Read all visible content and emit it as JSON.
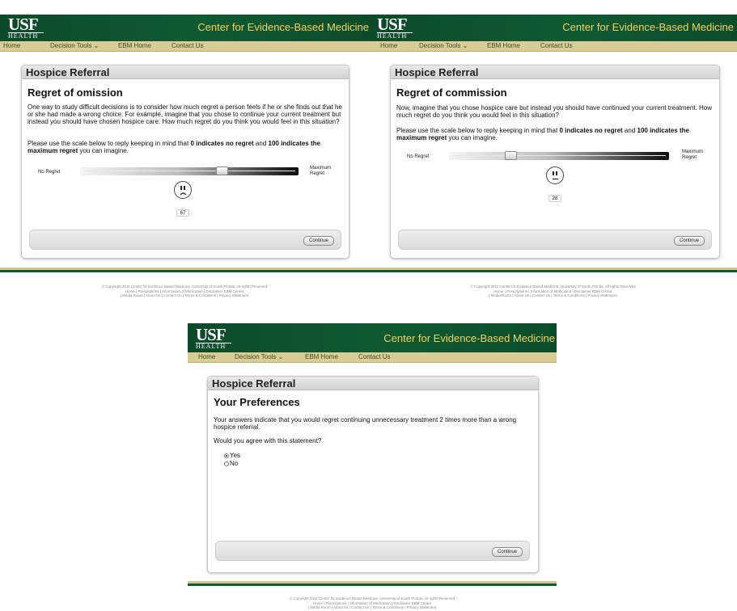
{
  "brand": {
    "logo": "USF",
    "logo_sub": "HEALTH",
    "site_title": "Center for Evidence-Based Medicine"
  },
  "nav": {
    "home": "Home",
    "decision_tools": "Decision Tools ⌄",
    "ebm_home": "EBM Home",
    "contact_us": "Contact Us"
  },
  "panel_a": {
    "header": "Hospice Referral",
    "title": "Regret of omission",
    "paragraph1": "One way to study difficult decisions is to consider how much regret a person feels if he or she finds out that he or she had made a wrong choice. For example, imagine that you chose to continue your current treatment but instead you should have chosen hospice care. How much regret do you think you would feel in this situation?",
    "instruction_pre": "Please use the scale below to reply keeping in mind that ",
    "instruction_b1": "0 indicates no regret",
    "instruction_mid": " and ",
    "instruction_b2": "100 indicates the maximum regret",
    "instruction_post": " you can imagine.",
    "scale_min_label": "No Regret",
    "scale_max_label": "Maximum Regret",
    "slider_value": "67",
    "continue_label": "Continue"
  },
  "panel_b": {
    "header": "Hospice Referral",
    "title": "Regret of commission",
    "paragraph1": "Now, imagine that you chose hospice care but instead you should have continued your current treatment. How much regret do you think you would feel in this situation?",
    "instruction_pre": "Please use the scale below to reply keeping in mind that ",
    "instruction_b1": "0 indicates no regret",
    "instruction_mid": " and ",
    "instruction_b2": "100 indicates the maximum regret",
    "instruction_post": " you can imagine.",
    "scale_min_label": "No Regret",
    "scale_max_label": "Maximum Regret",
    "slider_value": "28",
    "continue_label": "Continue"
  },
  "panel_c": {
    "header": "Hospice Referral",
    "title": "Your Preferences",
    "paragraph1": "Your answers indicate that you would regret continuing unnecessary treatment 2 times more than a wrong hospice referral.",
    "question": "Would you agree with this statement?",
    "option_yes": "Yes",
    "option_no": "No",
    "selected_option": "Yes",
    "continue_label": "Continue"
  },
  "footer": {
    "copyright": "© Copyright 2011 Center for Evidence Based Medicine, University of South Florida. All rights Reserved",
    "links_line1": "Home | Prescriptions | Information of Medication | Disclaimer EBM Center",
    "links_line2": "| Media Room | About Us | Contact Us | Terms & Conditions | Privacy Statement"
  },
  "colors": {
    "banner_green": "#0f5a33",
    "title_gold": "#f2d35a",
    "nav_tan": "#d9cd96"
  }
}
